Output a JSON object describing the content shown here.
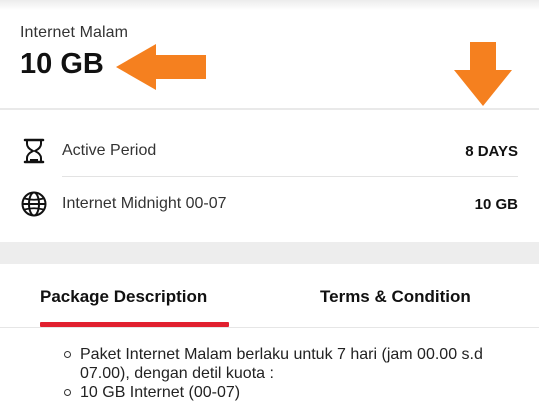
{
  "package": {
    "name": "Internet Malam",
    "size": "10 GB"
  },
  "details": [
    {
      "icon": "hourglass-icon",
      "label": "Active Period",
      "value": "8 DAYS"
    },
    {
      "icon": "globe-icon",
      "label": "Internet Midnight 00-07",
      "value": "10 GB"
    }
  ],
  "tabs": [
    {
      "label": "Package Description",
      "active": true
    },
    {
      "label": "Terms & Condition",
      "active": false
    }
  ],
  "description": {
    "items": [
      "Paket Internet Malam berlaku untuk 7 hari (jam 00.00 s.d 07.00), dengan detil kuota :",
      "10 GB Internet (00-07)"
    ]
  },
  "colors": {
    "accent": "#e1202f",
    "annotation_arrow": "#f5801f"
  }
}
